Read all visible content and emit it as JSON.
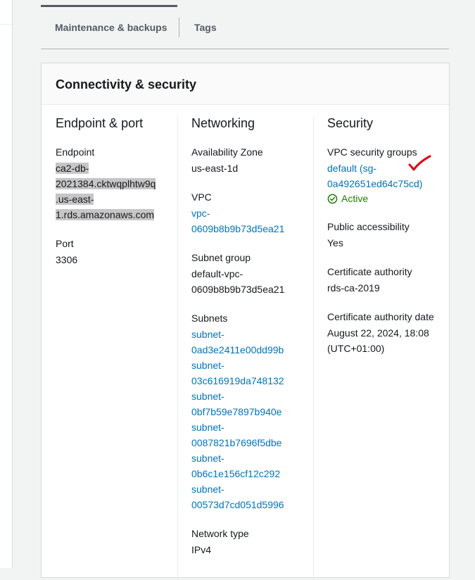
{
  "tabs": [
    {
      "label": "Maintenance & backups",
      "active": true
    },
    {
      "label": "Tags",
      "active": false
    }
  ],
  "panel": {
    "title": "Connectivity & security"
  },
  "endpoint_port": {
    "title": "Endpoint & port",
    "endpoint_label": "Endpoint",
    "endpoint_lines": [
      "ca2-db-",
      "2021384.cktwqplhtw9q",
      ".us-east-",
      "1.rds.amazonaws.com"
    ],
    "port_label": "Port",
    "port_value": "3306"
  },
  "networking": {
    "title": "Networking",
    "az_label": "Availability Zone",
    "az_value": "us-east-1d",
    "vpc_label": "VPC",
    "vpc_lines": [
      "vpc-",
      "0609b8b9b73d5ea21"
    ],
    "subnet_group_label": "Subnet group",
    "subnet_group_lines": [
      "default-vpc-",
      "0609b8b9b73d5ea21"
    ],
    "subnets_label": "Subnets",
    "subnets": [
      [
        "subnet-",
        "0ad3e2411e00dd99b"
      ],
      [
        "subnet-",
        "03c616919da748132"
      ],
      [
        "subnet-",
        "0bf7b59e7897b940e"
      ],
      [
        "subnet-",
        "0087821b7696f5dbe"
      ],
      [
        "subnet-",
        "0b6c1e156cf12c292"
      ],
      [
        "subnet-",
        "00573d7cd051d5996"
      ]
    ],
    "network_type_label": "Network type",
    "network_type_value": "IPv4"
  },
  "security": {
    "title": "Security",
    "vpc_sg_label": "VPC security groups",
    "vpc_sg_lines": [
      "default (sg-",
      "0a492651ed64c75cd)"
    ],
    "vpc_sg_status": "Active",
    "public_label": "Public accessibility",
    "public_value": "Yes",
    "cert_label": "Certificate authority",
    "cert_value": "rds-ca-2019",
    "cert_date_label": "Certificate authority date",
    "cert_date_lines": [
      "August 22, 2024, 18:08",
      "(UTC+01:00)"
    ]
  },
  "colors": {
    "link": "#0073bb",
    "status_ok": "#1d8102",
    "annotation": "#e0000f"
  },
  "icons": {
    "status": "status-ok-icon",
    "annotation": "red-checkmark-annotation"
  }
}
